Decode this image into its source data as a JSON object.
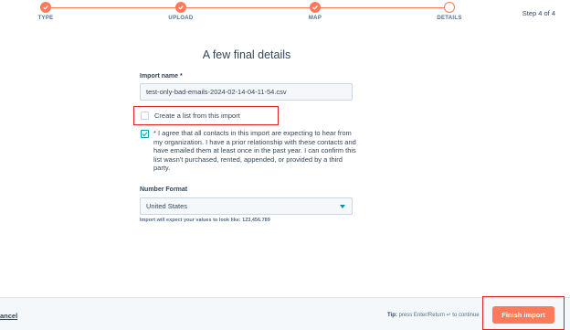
{
  "stepper": {
    "steps": [
      {
        "label": "TYPE",
        "state": "done"
      },
      {
        "label": "UPLOAD",
        "state": "done"
      },
      {
        "label": "MAP",
        "state": "done"
      },
      {
        "label": "DETAILS",
        "state": "current"
      }
    ],
    "step_count": "Step 4 of 4"
  },
  "main": {
    "title": "A few final details",
    "import_name_label": "Import name *",
    "import_name_value": "test-only-bad-emails-2024-02-14-04-11-54.csv",
    "create_list_label": "Create a list from this import",
    "create_list_checked": false,
    "consent_checked": true,
    "consent_text": "* I agree that all contacts in this import are expecting to hear from my organization. I have a prior relationship with these contacts and have emailed them at least once in the past year. I can confirm this list wasn't purchased, rented, appended, or provided by a third party.",
    "number_format_label": "Number Format",
    "number_format_value": "United States",
    "number_format_hint": "Import will expect your values to look like: 123,456.789"
  },
  "footer": {
    "cancel_label": "ancel",
    "tip_prefix": "Tip:",
    "tip_text": "press Enter/Return ↵ to continue",
    "finish_label": "Finish import"
  },
  "colors": {
    "accent": "#ff7a59",
    "checkbox_checked": "#00a4bd",
    "highlight_box": "#e02424"
  }
}
